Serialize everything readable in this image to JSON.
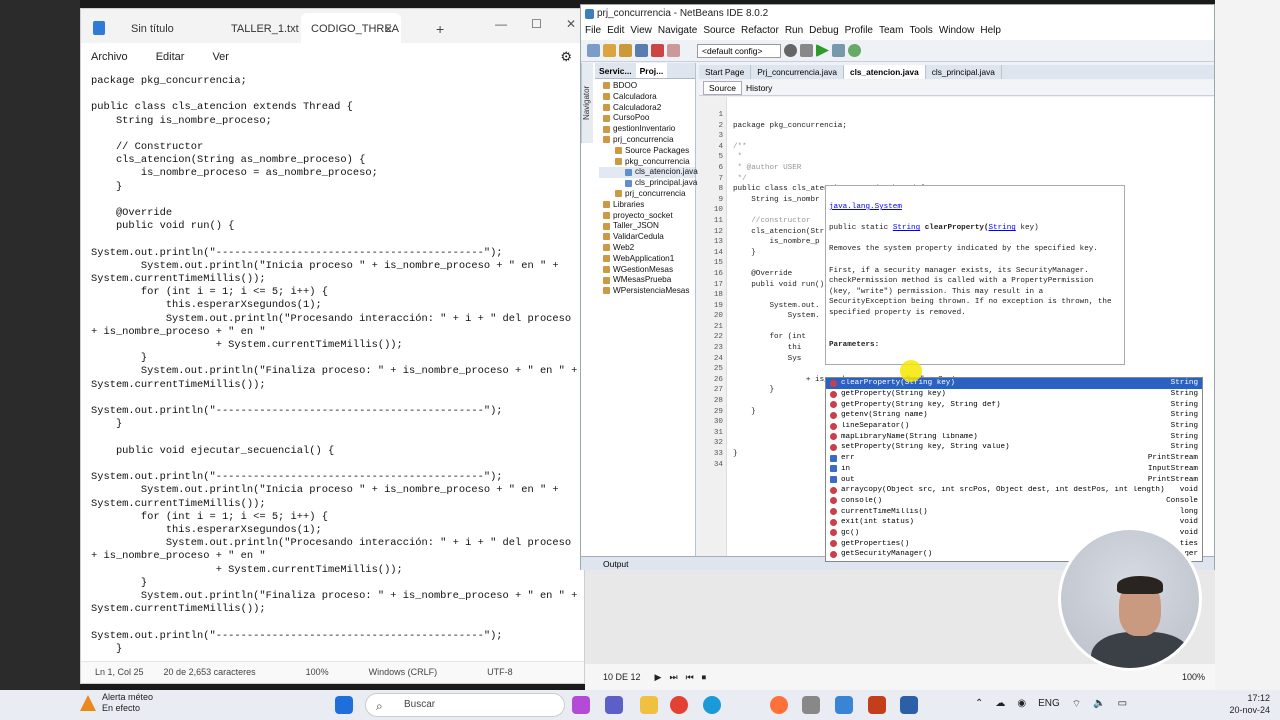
{
  "notepad": {
    "tabs": [
      "Sin título",
      "TALLER_1.txt",
      "CODIGO_THREA"
    ],
    "active_tab": 2,
    "menu": [
      "Archivo",
      "Editar",
      "Ver"
    ],
    "code_lines": [
      "package pkg_concurrencia;",
      "",
      "public class cls_atencion extends Thread {",
      "    String is_nombre_proceso;",
      "",
      "    // Constructor",
      "    cls_atencion(String as_nombre_proceso) {",
      "        is_nombre_proceso = as_nombre_proceso;",
      "    }",
      "",
      "    @Override",
      "    public void run() {",
      "",
      "System.out.println(\"-------------------------------------------\");",
      "        System.out.println(\"Inicia proceso \" + is_nombre_proceso + \" en \" +",
      "System.currentTimeMillis());",
      "        for (int i = 1; i <= 5; i++) {",
      "            this.esperarXsegundos(1);",
      "            System.out.println(\"Procesando interacción: \" + i + \" del proceso \"",
      "+ is_nombre_proceso + \" en \"",
      "                    + System.currentTimeMillis());",
      "        }",
      "        System.out.println(\"Finaliza proceso: \" + is_nombre_proceso + \" en \" +",
      "System.currentTimeMillis());",
      "",
      "System.out.println(\"-------------------------------------------\");",
      "    }",
      "",
      "    public void ejecutar_secuencial() {",
      "",
      "System.out.println(\"-------------------------------------------\");",
      "        System.out.println(\"Inicia proceso \" + is_nombre_proceso + \" en \" +",
      "System.currentTimeMillis());",
      "        for (int i = 1; i <= 5; i++) {",
      "            this.esperarXsegundos(1);",
      "            System.out.println(\"Procesando interacción: \" + i + \" del proceso \"",
      "+ is_nombre_proceso + \" en \"",
      "                    + System.currentTimeMillis());",
      "        }",
      "        System.out.println(\"Finaliza proceso: \" + is_nombre_proceso + \" en \" +",
      "System.currentTimeMillis());",
      "",
      "System.out.println(\"-------------------------------------------\");",
      "    }"
    ],
    "status": {
      "position": "Ln 1, Col 25",
      "chars": "20 de 2,653 caracteres",
      "zoom": "100%",
      "eol": "Windows (CRLF)",
      "encoding": "UTF-8"
    }
  },
  "netbeans": {
    "title": "prj_concurrencia - NetBeans IDE 8.0.2",
    "menu": [
      "File",
      "Edit",
      "View",
      "Navigate",
      "Source",
      "Refactor",
      "Run",
      "Debug",
      "Profile",
      "Team",
      "Tools",
      "Window",
      "Help"
    ],
    "config": "<default config>",
    "left_tabs": [
      "Servic...",
      "Proj..."
    ],
    "navigator_label": "Navigator",
    "tree": [
      {
        "label": "BDOO",
        "level": 1
      },
      {
        "label": "Calculadora",
        "level": 1
      },
      {
        "label": "Calculadora2",
        "level": 1
      },
      {
        "label": "CursoPoo",
        "level": 1
      },
      {
        "label": "gestionInventario",
        "level": 1
      },
      {
        "label": "prj_concurrencia",
        "level": 1
      },
      {
        "label": "Source Packages",
        "level": 2
      },
      {
        "label": "pkg_concurrencia",
        "level": 2
      },
      {
        "label": "cls_atencion.java",
        "level": 3
      },
      {
        "label": "cls_principal.java",
        "level": 3
      },
      {
        "label": "prj_concurrencia",
        "level": 2
      },
      {
        "label": "Libraries",
        "level": 1
      },
      {
        "label": "proyecto_socket",
        "level": 1
      },
      {
        "label": "Taller_JSON",
        "level": 1
      },
      {
        "label": "ValidarCedula",
        "level": 1
      },
      {
        "label": "Web2",
        "level": 1
      },
      {
        "label": "WebApplication1",
        "level": 1
      },
      {
        "label": "WGestionMesas",
        "level": 1
      },
      {
        "label": "WMesasPrueba",
        "level": 1
      },
      {
        "label": "WPersistenciaMesas",
        "level": 1
      }
    ],
    "editor_tabs": [
      "Start Page",
      "Prj_concurrencia.java",
      "cls_atencion.java",
      "cls_principal.java"
    ],
    "active_editor_tab": 2,
    "source_btn": "Source",
    "history_btn": "History",
    "line_numbers": [
      "1",
      "2",
      "3",
      "4",
      "5",
      "6",
      "7",
      "8",
      "9",
      "10",
      "11",
      "12",
      "13",
      "14",
      "15",
      "16",
      "17",
      "18",
      "19",
      "20",
      "21",
      "22",
      "23",
      "24",
      "25",
      "26",
      "27",
      "28",
      "29",
      "30",
      "31",
      "32",
      "33",
      "34"
    ],
    "code": [
      "",
      "package pkg_concurrencia;",
      "",
      "/**",
      " *",
      " * @author USER",
      " */",
      "public class cls_atencion extends Thread {",
      "    String is_nombr",
      "",
      "    //constructor",
      "    cls_atencion(Str",
      "        is_nombre_p",
      "    }",
      "",
      "    @Override",
      "    publi void run()",
      "",
      "        System.out.",
      "            System.",
      "",
      "        for (int",
      "            thi",
      "            Sys",
      "",
      "                + is_nombre_proceso + \"en\" + System.",
      "        }",
      "",
      "    }",
      "",
      "",
      "",
      "}",
      ""
    ],
    "output_label": "Output"
  },
  "javadoc": {
    "class": "java.lang.System",
    "signature_pre": "public static ",
    "signature_type": "String",
    "signature_name": " clearProperty(",
    "signature_param": "String",
    "signature_post": " key)",
    "text1": "Removes the system property indicated by the specified key.",
    "text2": "First, if a security manager exists, its SecurityManager. checkPermission method is called with a PropertyPermission (key, \"write\") permission. This may result in a SecurityException being thrown. If no exception is thrown, the specified property is removed.",
    "params": "Parameters:"
  },
  "completion": [
    {
      "name": "clearProperty(String key)",
      "type": "String",
      "kind": "m"
    },
    {
      "name": "getProperty(String key)",
      "type": "String",
      "kind": "m"
    },
    {
      "name": "getProperty(String key, String def)",
      "type": "String",
      "kind": "m"
    },
    {
      "name": "getenv(String name)",
      "type": "String",
      "kind": "m"
    },
    {
      "name": "lineSeparator()",
      "type": "String",
      "kind": "m"
    },
    {
      "name": "mapLibraryName(String libname)",
      "type": "String",
      "kind": "m"
    },
    {
      "name": "setProperty(String key, String value)",
      "type": "String",
      "kind": "m"
    },
    {
      "name": "err",
      "type": "PrintStream",
      "kind": "f"
    },
    {
      "name": "in",
      "type": "InputStream",
      "kind": "f"
    },
    {
      "name": "out",
      "type": "PrintStream",
      "kind": "f"
    },
    {
      "name": "arraycopy(Object src, int srcPos, Object dest, int destPos, int length)",
      "type": "void",
      "kind": "m"
    },
    {
      "name": "console()",
      "type": "Console",
      "kind": "m"
    },
    {
      "name": "currentTimeMillis()",
      "type": "long",
      "kind": "m"
    },
    {
      "name": "exit(int status)",
      "type": "void",
      "kind": "m"
    },
    {
      "name": "gc()",
      "type": "void",
      "kind": "m"
    },
    {
      "name": "getProperties()",
      "type": "ties",
      "kind": "m"
    },
    {
      "name": "getSecurityManager()",
      "type": "ger",
      "kind": "m"
    }
  ],
  "player": {
    "time": "10 DE 12",
    "zoom": "100%"
  },
  "taskbar": {
    "weather_title": "Alerta méteo",
    "weather_sub": "En efecto",
    "search": "Buscar",
    "lang": "ENG",
    "time": "17:12",
    "date": "20-nov-24"
  }
}
